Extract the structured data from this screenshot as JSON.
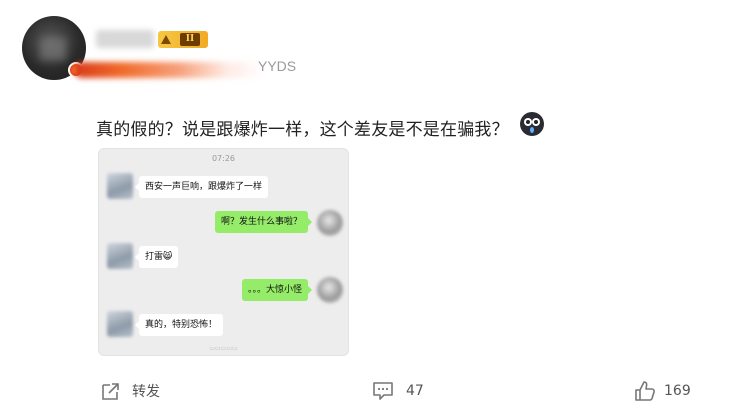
{
  "post": {
    "author_subtitle": "YYDS",
    "level_badge": "II",
    "text": "真的假的？说是跟爆炸一样，这个差友是不是在骗我？",
    "emoji_icon": "crying-face-icon"
  },
  "chat_screenshot": {
    "time": "07:26",
    "messages": [
      {
        "side": "left",
        "text": "西安一声巨响，跟爆炸了一样"
      },
      {
        "side": "right",
        "text": "啊？发生什么事啦？"
      },
      {
        "side": "left",
        "text": "打雷😸"
      },
      {
        "side": "right",
        "text": "。。。大惊小怪"
      },
      {
        "side": "left",
        "text": "真的，特别恐怖！"
      }
    ]
  },
  "actions": {
    "repost_label": "转发",
    "comment_count": "47",
    "like_count": "169"
  },
  "colors": {
    "bubble_right": "#95ec69",
    "chat_background": "#ededed",
    "badge_gold": "#f6c744"
  }
}
